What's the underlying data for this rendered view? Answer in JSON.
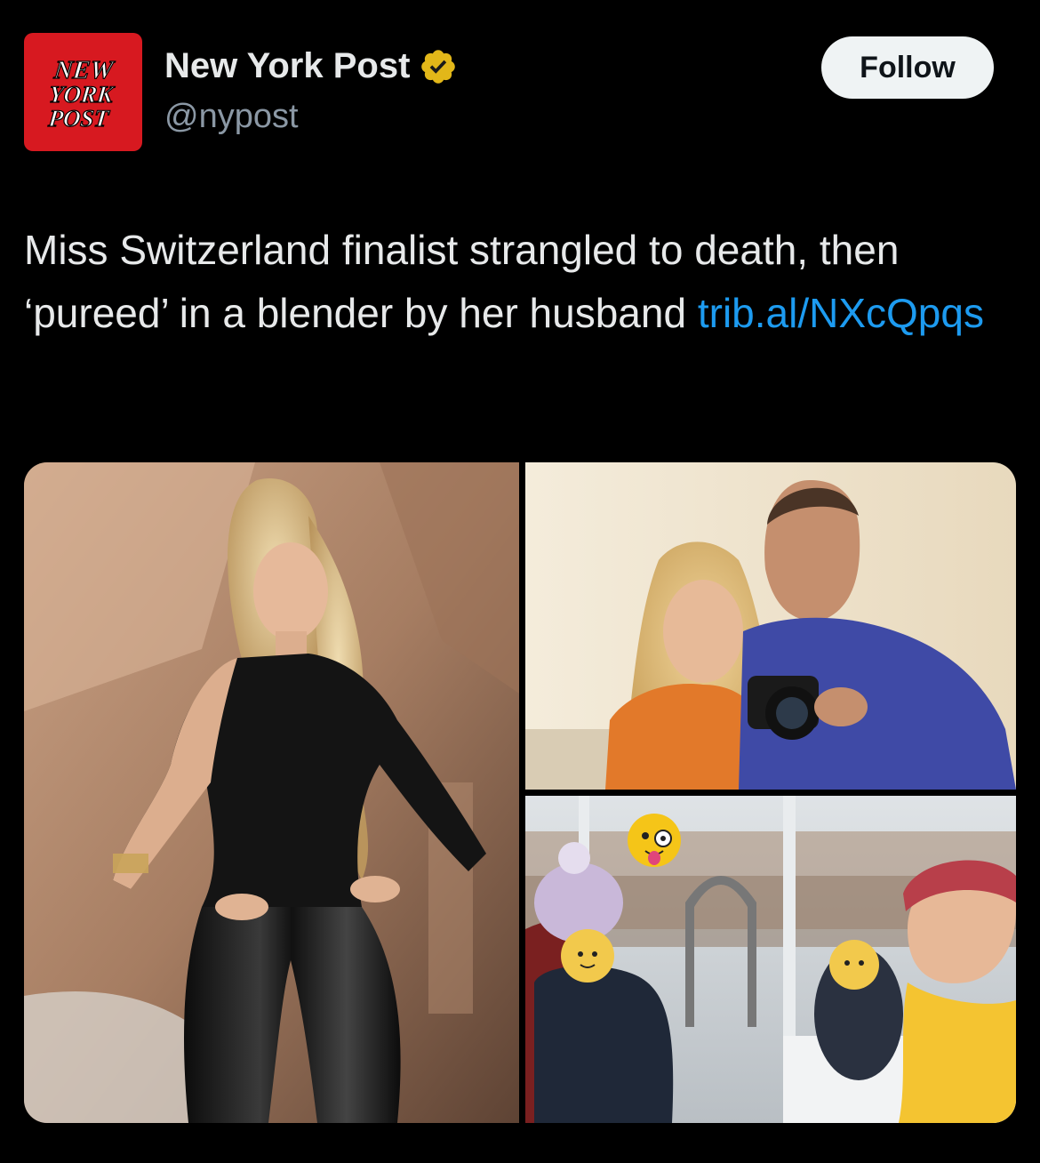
{
  "account": {
    "display_name": "New York Post",
    "handle": "@nypost",
    "avatar_logo_lines": [
      "NEW",
      "YORK",
      "POST"
    ],
    "verified": true
  },
  "actions": {
    "follow_label": "Follow"
  },
  "tweet": {
    "text": "Miss Switzerland finalist strangled to death, then ‘pureed’ in a blender by her husband ",
    "link_text": "trib.al/NXcQpqs"
  },
  "media": {
    "photo_count": 3,
    "photos": [
      {
        "name": "photo-woman-black-outfit"
      },
      {
        "name": "photo-couple-with-camera"
      },
      {
        "name": "photo-family-ferris-wheel"
      }
    ]
  },
  "colors": {
    "background": "#000000",
    "text_primary": "#e7e9ea",
    "text_secondary": "#8b98a5",
    "link": "#1d9bf0",
    "brand_red": "#d71920",
    "verified_gold": "#e2b719",
    "follow_button_bg": "#eff3f4"
  }
}
